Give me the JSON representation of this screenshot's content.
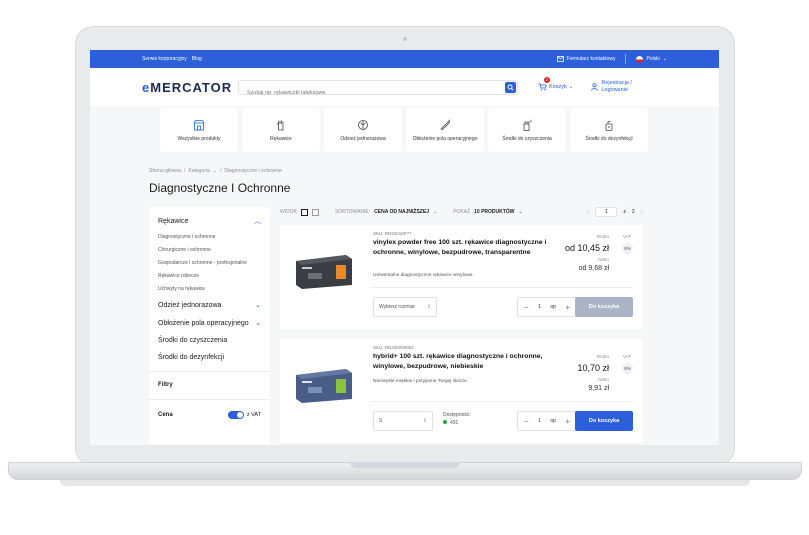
{
  "topbar": {
    "links": [
      "Serwis korporacyjny",
      "Blog"
    ],
    "contact_form": "Formularz kontaktowy",
    "language": "Polski"
  },
  "header": {
    "logo_prefix": "e",
    "logo_main": "MERCATOR",
    "search_placeholder": "Szukaj np. rękawiczki lateksowe",
    "cart_label": "Koszyk",
    "cart_count": "2",
    "account_line1": "Rejestracja /",
    "account_line2": "Logowanie"
  },
  "categories": [
    {
      "label": "Wszystkie produkty",
      "icon": "shop-icon"
    },
    {
      "label": "Rękawice",
      "icon": "glove-icon"
    },
    {
      "label": "Odzież jednorazowa",
      "icon": "shirt-icon"
    },
    {
      "label": "Obłożenie pola operacyjnego",
      "icon": "scalpel-icon"
    },
    {
      "label": "Środki do czyszczenia",
      "icon": "spray-icon"
    },
    {
      "label": "Środki do dezynfekcji",
      "icon": "sanitizer-icon"
    }
  ],
  "breadcrumb": [
    "Strona główna",
    "/",
    "Kategoria",
    "/",
    "Diagnostyczne i ochronne"
  ],
  "page_title": "Diagnostyczne I Ochronne",
  "sidebar": {
    "section": "Rękawice",
    "subitems": [
      "Diagnostyczne i ochronne",
      "Chirurgiczne i ochronne",
      "Gospodarcze i ochronne - profesjonalne",
      "Rękawice robocze",
      "Uchwyty na rękawice"
    ],
    "items": [
      {
        "label": "Odzież jednorazowa",
        "expandable": true
      },
      {
        "label": "Obłożenie pola operacyjnego",
        "expandable": true
      },
      {
        "label": "Środki do czyszczenia",
        "expandable": false
      },
      {
        "label": "Środki do dezynfekcji",
        "expandable": false
      }
    ],
    "filters_title": "Filtry",
    "price_label": "Cena",
    "vat_toggle_label": "z VAT"
  },
  "toolbar": {
    "view_label": "WIDOK",
    "sort_label": "SORTOWANIE:",
    "sort_value": "CENA OD NAJNIŻSZEJ",
    "show_label": "POKAŻ",
    "show_value": "10 PRODUKTÓW",
    "page_current": "1",
    "page_of": "z",
    "page_total": "2"
  },
  "products": [
    {
      "sku": "SKU: RD220180***",
      "name": "vinylex powder free 100 szt. rękawice diagnostyczne i ochronne, winylowe, bezpudrowe, transparentne",
      "description": "Uniwersalne diagnostyczne rękawice winylowe.",
      "gross_label": "Brutto",
      "gross_price": "od 10,45 zł",
      "vat_label": "VAT",
      "vat_value": "8%",
      "net_label": "Netto",
      "net_price": "od 9,68 zł",
      "size_select": "Wybierz rozmiar",
      "quantity": "1",
      "unit": "op",
      "button": "Do koszyka",
      "button_color": "#aab4c6"
    },
    {
      "sku": "SKU: RD220259002",
      "name": "hybrid+ 100 szt. rękawice diagnostyczne i ochronne, winylowe, bezpudrowe, niebieskie",
      "description": "Niezwykle miękkie i przyjazne Twojej skórze.",
      "gross_label": "Brutto",
      "gross_price": "10,70 zł",
      "vat_label": "VAT",
      "vat_value": "8%",
      "net_label": "Netto",
      "net_price": "9,91 zł",
      "size_select": "S",
      "availability_label": "Dostępność:",
      "availability_value": "491",
      "quantity": "1",
      "unit": "op",
      "button": "Do koszyka",
      "button_color": "#2c5fd9"
    }
  ],
  "colors": {
    "accent": "#2c5fd9",
    "available": "#27a843"
  }
}
